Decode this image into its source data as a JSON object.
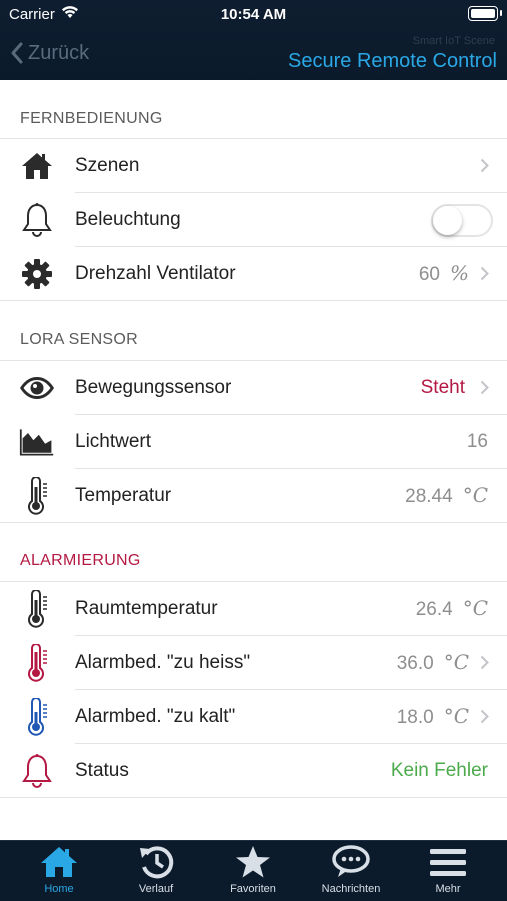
{
  "status_bar": {
    "carrier": "Carrier",
    "time": "10:54 AM"
  },
  "nav": {
    "back_label": "Zurück",
    "ghost_text": "Smart IoT Scene",
    "title": "Secure Remote Control"
  },
  "sections": {
    "remote": {
      "header": "FERNBEDIENUNG",
      "scenes": {
        "label": "Szenen"
      },
      "lighting": {
        "label": "Beleuchtung",
        "toggle_on": false
      },
      "fan": {
        "label": "Drehzahl Ventilator",
        "value": "60",
        "unit": "%"
      }
    },
    "lora": {
      "header": "LORA SENSOR",
      "motion": {
        "label": "Bewegungssensor",
        "value": "Steht"
      },
      "light": {
        "label": "Lichtwert",
        "value": "16"
      },
      "temp": {
        "label": "Temperatur",
        "value": "28.44",
        "unit": "°C"
      }
    },
    "alarm": {
      "header": "ALARMIERUNG",
      "room_temp": {
        "label": "Raumtemperatur",
        "value": "26.4",
        "unit": "°C"
      },
      "too_hot": {
        "label": "Alarmbed. \"zu heiss\"",
        "value": "36.0",
        "unit": "°C"
      },
      "too_cold": {
        "label": "Alarmbed. \"zu kalt\"",
        "value": "18.0",
        "unit": "°C"
      },
      "status": {
        "label": "Status",
        "value": "Kein Fehler"
      }
    }
  },
  "tabbar": {
    "home": "Home",
    "history": "Verlauf",
    "favorites": "Favoriten",
    "messages": "Nachrichten",
    "more": "Mehr"
  },
  "colors": {
    "header_bg": "#0e1e30",
    "accent": "#2aa8e6",
    "alarm_red": "#b31942",
    "ok_green": "#4caa4c",
    "cold_blue": "#1e58b4"
  }
}
